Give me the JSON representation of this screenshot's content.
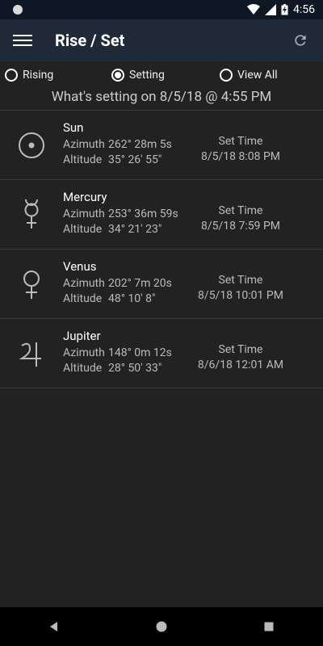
{
  "status": {
    "time": "4:56"
  },
  "appbar": {
    "title": "Rise / Set"
  },
  "filter": {
    "options": [
      "Rising",
      "Setting",
      "View All"
    ],
    "selected": "Setting"
  },
  "headline": "What's setting on 8/5/18 @ 4:55 PM",
  "bodies": [
    {
      "name": "Sun",
      "icon": "sun-icon",
      "azimuth": "262° 28m 5s",
      "altitude": "35° 26' 55\"",
      "set_label": "Set Time",
      "set_time": "8/5/18 8:08 PM"
    },
    {
      "name": "Mercury",
      "icon": "mercury-icon",
      "azimuth": "253° 36m 59s",
      "altitude": "34° 21' 23\"",
      "set_label": "Set Time",
      "set_time": "8/5/18 7:59 PM"
    },
    {
      "name": "Venus",
      "icon": "venus-icon",
      "azimuth": "202° 7m 20s",
      "altitude": "48° 10' 8\"",
      "set_label": "Set Time",
      "set_time": "8/5/18 10:01 PM"
    },
    {
      "name": "Jupiter",
      "icon": "jupiter-icon",
      "azimuth": "148° 0m 12s",
      "altitude": "28° 50' 33\"",
      "set_label": "Set Time",
      "set_time": "8/6/18 12:01 AM"
    }
  ],
  "labels": {
    "azimuth": "Azimuth",
    "altitude": "Altitude"
  }
}
